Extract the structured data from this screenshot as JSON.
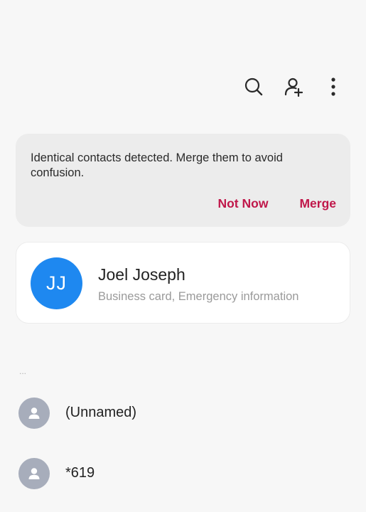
{
  "toolbar": {
    "search_icon": "search-icon",
    "add_contact_icon": "add-contact-icon",
    "more_icon": "more-vertical-icon"
  },
  "banner": {
    "message": "Identical contacts detected. Merge them to avoid confusion.",
    "not_now_label": "Not Now",
    "merge_label": "Merge",
    "accent_color": "#c0174a"
  },
  "profile": {
    "initials": "JJ",
    "name": "Joel Joseph",
    "subtitle": "Business card, Emergency information",
    "avatar_color": "#1e88f0"
  },
  "section_header": "...",
  "contacts": [
    {
      "name": "(Unnamed)"
    },
    {
      "name": "*619"
    }
  ]
}
